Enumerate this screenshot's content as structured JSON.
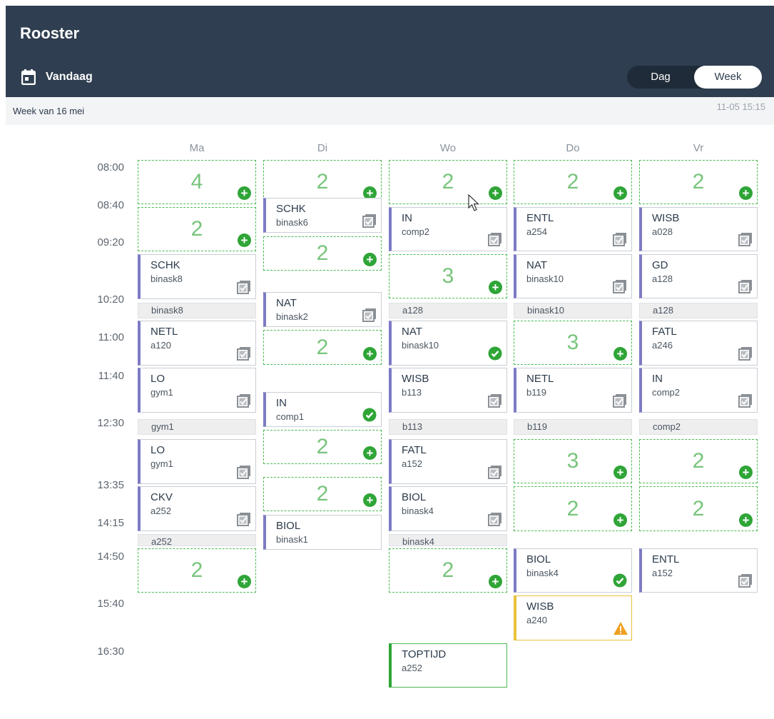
{
  "header": {
    "title": "Rooster",
    "today_label": "Vandaag",
    "view_day": "Dag",
    "view_week": "Week"
  },
  "subheader": {
    "week_label": "Week van 16 mei",
    "updated": "11-05 15:15"
  },
  "days": [
    "Ma",
    "Di",
    "Wo",
    "Do",
    "Vr"
  ],
  "times": [
    "08:00",
    "08:40",
    "09:20",
    "10:20",
    "11:00",
    "11:40",
    "12:30",
    "13:35",
    "14:15",
    "14:50",
    "15:40",
    "16:30"
  ],
  "colors": {
    "header_bg": "#2f3e50",
    "slot_green": "#4cba55",
    "lesson_accent": "#7d7bc4",
    "warning": "#f0a020",
    "done": "#2fa537"
  },
  "schedule": [
    {
      "type": "slot",
      "day": 0,
      "count": "4"
    },
    {
      "type": "slot",
      "day": 0,
      "count": "2"
    },
    {
      "type": "lesson",
      "day": 0,
      "subject": "SCHK",
      "room": "binask8",
      "icon": "review-icon"
    },
    {
      "type": "gap",
      "day": 0,
      "room": "binask8"
    },
    {
      "type": "lesson",
      "day": 0,
      "subject": "NETL",
      "room": "a120",
      "icon": "review-icon"
    },
    {
      "type": "lesson",
      "day": 0,
      "subject": "LO",
      "room": "gym1",
      "icon": "review-icon"
    },
    {
      "type": "gap",
      "day": 0,
      "room": "gym1"
    },
    {
      "type": "lesson",
      "day": 0,
      "subject": "LO",
      "room": "gym1",
      "icon": "review-icon"
    },
    {
      "type": "lesson",
      "day": 0,
      "subject": "CKV",
      "room": "a252",
      "icon": "review-icon"
    },
    {
      "type": "gap",
      "day": 0,
      "room": "a252"
    },
    {
      "type": "slot",
      "day": 0,
      "count": "2"
    },
    {
      "type": "slot",
      "day": 1,
      "count": "2"
    },
    {
      "type": "lesson",
      "day": 1,
      "subject": "SCHK",
      "room": "binask6",
      "icon": "review-icon"
    },
    {
      "type": "slot",
      "day": 1,
      "count": "2"
    },
    {
      "type": "lesson",
      "day": 1,
      "subject": "NAT",
      "room": "binask2",
      "icon": "review-icon"
    },
    {
      "type": "slot",
      "day": 1,
      "count": "2"
    },
    {
      "type": "lesson",
      "day": 1,
      "subject": "IN",
      "room": "comp1",
      "icon": "check-icon"
    },
    {
      "type": "slot",
      "day": 1,
      "count": "2"
    },
    {
      "type": "slot",
      "day": 1,
      "count": "2"
    },
    {
      "type": "lesson",
      "day": 1,
      "subject": "BIOL",
      "room": "binask1",
      "icon": "none"
    },
    {
      "type": "slot",
      "day": 2,
      "count": "2"
    },
    {
      "type": "lesson",
      "day": 2,
      "subject": "IN",
      "room": "comp2",
      "icon": "review-icon"
    },
    {
      "type": "slot",
      "day": 2,
      "count": "3"
    },
    {
      "type": "gap",
      "day": 2,
      "room": "a128"
    },
    {
      "type": "lesson",
      "day": 2,
      "subject": "NAT",
      "room": "binask10",
      "icon": "check-icon"
    },
    {
      "type": "lesson",
      "day": 2,
      "subject": "WISB",
      "room": "b113",
      "icon": "review-icon"
    },
    {
      "type": "gap",
      "day": 2,
      "room": "b113"
    },
    {
      "type": "lesson",
      "day": 2,
      "subject": "FATL",
      "room": "a152",
      "icon": "review-icon"
    },
    {
      "type": "lesson",
      "day": 2,
      "subject": "BIOL",
      "room": "binask4",
      "icon": "review-icon"
    },
    {
      "type": "gap",
      "day": 2,
      "room": "binask4"
    },
    {
      "type": "slot",
      "day": 2,
      "count": "2"
    },
    {
      "type": "lesson",
      "day": 2,
      "subject": "TOPTIJD",
      "room": "a252",
      "icon": "none",
      "variant": "green"
    },
    {
      "type": "slot",
      "day": 3,
      "count": "2"
    },
    {
      "type": "lesson",
      "day": 3,
      "subject": "ENTL",
      "room": "a254",
      "icon": "review-icon"
    },
    {
      "type": "lesson",
      "day": 3,
      "subject": "NAT",
      "room": "binask10",
      "icon": "review-icon"
    },
    {
      "type": "gap",
      "day": 3,
      "room": "binask10"
    },
    {
      "type": "slot",
      "day": 3,
      "count": "3"
    },
    {
      "type": "lesson",
      "day": 3,
      "subject": "NETL",
      "room": "b119",
      "icon": "review-icon"
    },
    {
      "type": "gap",
      "day": 3,
      "room": "b119"
    },
    {
      "type": "slot",
      "day": 3,
      "count": "3"
    },
    {
      "type": "slot",
      "day": 3,
      "count": "2"
    },
    {
      "type": "lesson",
      "day": 3,
      "subject": "BIOL",
      "room": "binask4",
      "icon": "check-icon"
    },
    {
      "type": "lesson",
      "day": 3,
      "subject": "WISB",
      "room": "a240",
      "icon": "warning-icon",
      "variant": "warn"
    },
    {
      "type": "slot",
      "day": 4,
      "count": "2"
    },
    {
      "type": "lesson",
      "day": 4,
      "subject": "WISB",
      "room": "a028",
      "icon": "review-icon"
    },
    {
      "type": "lesson",
      "day": 4,
      "subject": "GD",
      "room": "a128",
      "icon": "review-icon"
    },
    {
      "type": "gap",
      "day": 4,
      "room": "a128"
    },
    {
      "type": "lesson",
      "day": 4,
      "subject": "FATL",
      "room": "a246",
      "icon": "review-icon"
    },
    {
      "type": "lesson",
      "day": 4,
      "subject": "IN",
      "room": "comp2",
      "icon": "review-icon"
    },
    {
      "type": "gap",
      "day": 4,
      "room": "comp2"
    },
    {
      "type": "slot",
      "day": 4,
      "count": "2"
    },
    {
      "type": "slot",
      "day": 4,
      "count": "2"
    },
    {
      "type": "lesson",
      "day": 4,
      "subject": "ENTL",
      "room": "a152",
      "icon": "review-icon"
    }
  ]
}
